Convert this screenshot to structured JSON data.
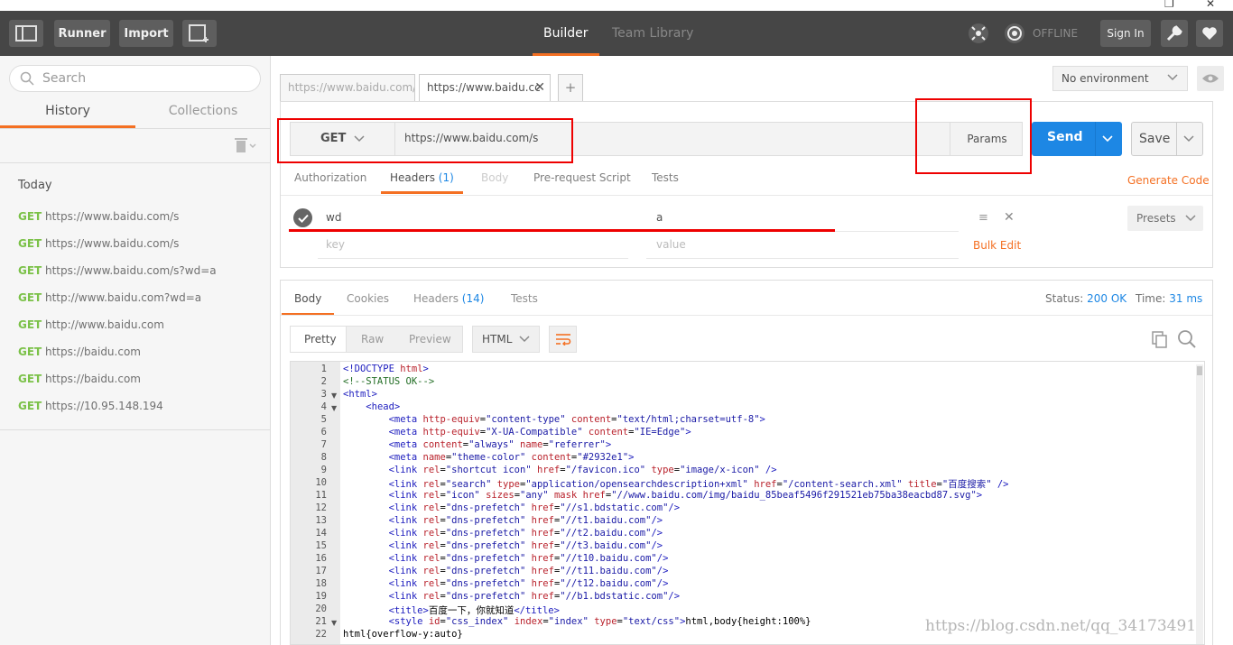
{
  "topbar": {
    "runner_label": "Runner",
    "import_label": "Import",
    "tabs": [
      {
        "label": "Builder",
        "active": true
      },
      {
        "label": "Team Library",
        "active": false
      }
    ],
    "offline_label": "OFFLINE",
    "signin_label": "Sign In"
  },
  "sidebar": {
    "search_placeholder": "Search",
    "tabs": [
      {
        "label": "History",
        "active": true
      },
      {
        "label": "Collections",
        "active": false
      }
    ],
    "group_label": "Today",
    "history": [
      {
        "method": "GET",
        "url": "https://www.baidu.com/s"
      },
      {
        "method": "GET",
        "url": "https://www.baidu.com/s"
      },
      {
        "method": "GET",
        "url": "https://www.baidu.com/s?wd=a"
      },
      {
        "method": "GET",
        "url": "http://www.baidu.com?wd=a"
      },
      {
        "method": "GET",
        "url": "http://www.baidu.com"
      },
      {
        "method": "GET",
        "url": "https://baidu.com"
      },
      {
        "method": "GET",
        "url": "https://baidu.com"
      },
      {
        "method": "GET",
        "url": "https://10.95.148.194"
      }
    ]
  },
  "request_tabs": [
    {
      "label": "https://www.baidu.com/",
      "active": false
    },
    {
      "label": "https://www.baidu.cc",
      "active": true
    }
  ],
  "environment": {
    "selected": "No environment"
  },
  "request": {
    "method": "GET",
    "url": "https://www.baidu.com/s",
    "params_label": "Params",
    "send_label": "Send",
    "save_label": "Save"
  },
  "request_subtabs": {
    "authorization": "Authorization",
    "headers": "Headers",
    "headers_count": "(1)",
    "body": "Body",
    "prerequest": "Pre-request Script",
    "tests": "Tests",
    "generate_code": "Generate Code"
  },
  "headers_rows": {
    "key": "wd",
    "value": "a",
    "key_placeholder": "key",
    "value_placeholder": "value",
    "bulk_edit": "Bulk Edit",
    "presets": "Presets"
  },
  "response": {
    "tabs": {
      "body": "Body",
      "cookies": "Cookies",
      "headers": "Headers",
      "headers_count": "(14)",
      "tests": "Tests"
    },
    "status_label": "Status:",
    "status_value": "200 OK",
    "time_label": "Time:",
    "time_value": "31 ms",
    "formats": [
      "Pretty",
      "Raw",
      "Preview"
    ],
    "active_format": "Pretty",
    "language": "HTML"
  },
  "code_lines": [
    "<!DOCTYPE html>",
    "<!--STATUS OK-->",
    "<html>",
    "    <head>",
    "        <meta http-equiv=\"content-type\" content=\"text/html;charset=utf-8\">",
    "        <meta http-equiv=\"X-UA-Compatible\" content=\"IE=Edge\">",
    "        <meta content=\"always\" name=\"referrer\">",
    "        <meta name=\"theme-color\" content=\"#2932e1\">",
    "        <link rel=\"shortcut icon\" href=\"/favicon.ico\" type=\"image/x-icon\" />",
    "        <link rel=\"search\" type=\"application/opensearchdescription+xml\" href=\"/content-search.xml\" title=\"百度搜索\" />",
    "        <link rel=\"icon\" sizes=\"any\" mask href=\"//www.baidu.com/img/baidu_85beaf5496f291521eb75ba38eacbd87.svg\">",
    "        <link rel=\"dns-prefetch\" href=\"//s1.bdstatic.com\"/>",
    "        <link rel=\"dns-prefetch\" href=\"//t1.baidu.com\"/>",
    "        <link rel=\"dns-prefetch\" href=\"//t2.baidu.com\"/>",
    "        <link rel=\"dns-prefetch\" href=\"//t3.baidu.com\"/>",
    "        <link rel=\"dns-prefetch\" href=\"//t10.baidu.com\"/>",
    "        <link rel=\"dns-prefetch\" href=\"//t11.baidu.com\"/>",
    "        <link rel=\"dns-prefetch\" href=\"//t12.baidu.com\"/>",
    "        <link rel=\"dns-prefetch\" href=\"//b1.bdstatic.com\"/>",
    "        <title>百度一下，你就知道</title>",
    "        <style id=\"css_index\" index=\"index\" type=\"text/css\">html,body{height:100%}",
    "html{overflow-y:auto}"
  ],
  "watermark": "https://blog.csdn.net/qq_34173491",
  "colors": {
    "accent": "#f47023",
    "send": "#1d87e4",
    "method_get": "#7bc148",
    "annotation": "#e00000"
  }
}
